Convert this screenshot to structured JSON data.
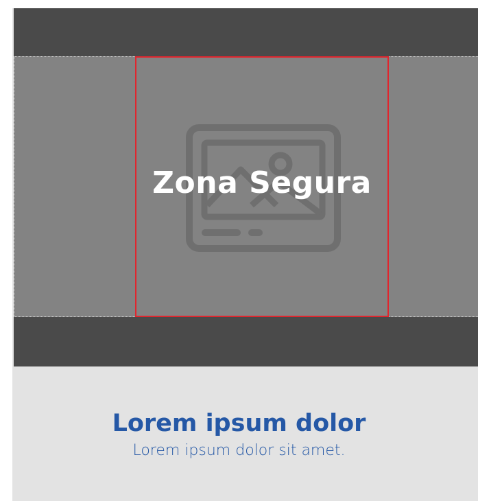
{
  "media": {
    "icon": "image-placeholder-icon",
    "safe_zone_label": "Zona Segura",
    "safe_zone_color": "#e0262e"
  },
  "content": {
    "title": "Lorem ipsum dolor",
    "subtitle": "Lorem ipsum dolor sit amet."
  },
  "colors": {
    "band": "#4a4a4a",
    "image_area": "#838383",
    "card_background": "#e3e3e3",
    "text_accent": "#2558a6"
  }
}
